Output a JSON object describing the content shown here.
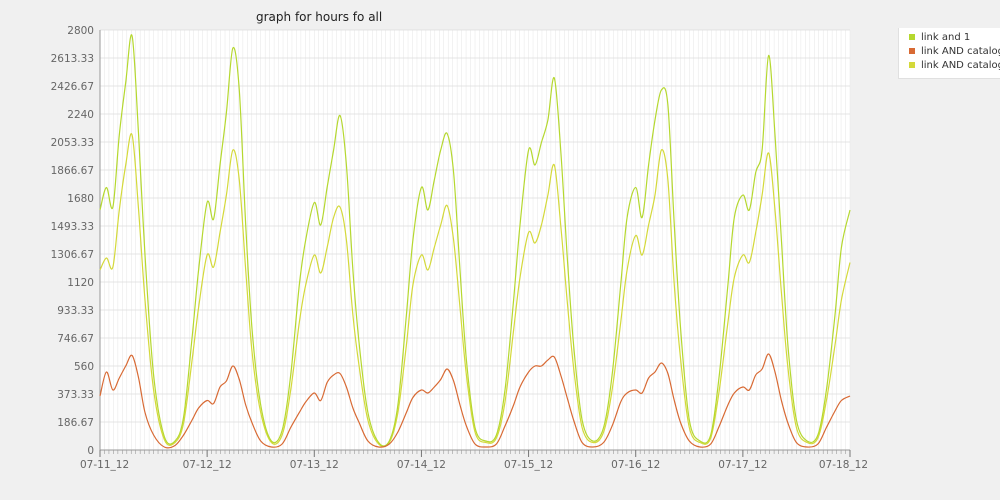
{
  "colors": {
    "background": "#f0f0f0",
    "plot_background": "#ffffff",
    "grid": "#e6e6e6",
    "axis": "#999999"
  },
  "chart_data": {
    "type": "line",
    "title": "graph for hours fo all",
    "xlabel": "",
    "ylabel": "",
    "ylim": [
      0,
      2800
    ],
    "y_ticks": [
      "0",
      "186.67",
      "373.33",
      "560",
      "746.67",
      "933.33",
      "1120",
      "1306.67",
      "1493.33",
      "1680",
      "1866.67",
      "2053.33",
      "2240",
      "2426.67",
      "2613.33",
      "2800"
    ],
    "x_ticks": [
      "07-11_12",
      "07-12_12",
      "07-13_12",
      "07-14_12",
      "07-15_12",
      "07-16_12",
      "07-17_12",
      "07-18_12"
    ],
    "grid": true,
    "legend_position": "top-right",
    "series": [
      {
        "name": "link and 1",
        "color": "#b5d82f",
        "x": [
          0,
          0.06,
          0.12,
          0.18,
          0.24,
          0.3,
          0.36,
          0.42,
          0.5,
          0.6,
          0.7,
          0.78,
          0.86,
          0.92,
          1.0,
          1.06,
          1.12,
          1.18,
          1.24,
          1.3,
          1.36,
          1.42,
          1.5,
          1.6,
          1.7,
          1.78,
          1.86,
          1.92,
          2.0,
          2.06,
          2.12,
          2.18,
          2.24,
          2.3,
          2.36,
          2.42,
          2.5,
          2.6,
          2.7,
          2.78,
          2.86,
          2.92,
          3.0,
          3.06,
          3.12,
          3.18,
          3.24,
          3.3,
          3.36,
          3.42,
          3.5,
          3.6,
          3.7,
          3.78,
          3.86,
          3.92,
          4.0,
          4.06,
          4.12,
          4.18,
          4.24,
          4.3,
          4.36,
          4.42,
          4.5,
          4.6,
          4.7,
          4.78,
          4.86,
          4.92,
          5.0,
          5.06,
          5.12,
          5.18,
          5.24,
          5.3,
          5.36,
          5.42,
          5.5,
          5.6,
          5.7,
          5.78,
          5.86,
          5.92,
          6.0,
          6.06,
          6.12,
          6.18,
          6.24,
          6.3,
          6.36,
          6.42,
          6.5,
          6.6,
          6.7,
          6.78,
          6.86,
          6.92,
          7.0
        ],
        "values": [
          1600,
          1750,
          1620,
          2100,
          2450,
          2760,
          2100,
          1300,
          500,
          90,
          60,
          220,
          750,
          1200,
          1650,
          1540,
          1900,
          2250,
          2680,
          2400,
          1500,
          800,
          300,
          60,
          130,
          500,
          1100,
          1400,
          1650,
          1500,
          1750,
          2000,
          2230,
          1900,
          1200,
          700,
          250,
          50,
          60,
          300,
          900,
          1400,
          1750,
          1600,
          1800,
          2000,
          2110,
          1850,
          1200,
          600,
          150,
          60,
          100,
          400,
          1000,
          1500,
          2000,
          1900,
          2050,
          2200,
          2480,
          2000,
          1300,
          700,
          200,
          60,
          150,
          500,
          1100,
          1550,
          1750,
          1550,
          1900,
          2200,
          2400,
          2300,
          1500,
          800,
          200,
          60,
          100,
          500,
          1100,
          1550,
          1700,
          1600,
          1850,
          2000,
          2630,
          2100,
          1400,
          700,
          200,
          60,
          100,
          400,
          900,
          1350,
          1600
        ]
      },
      {
        "name": "link AND catalog",
        "color": "#d86a34",
        "x": [
          0,
          0.06,
          0.12,
          0.18,
          0.24,
          0.3,
          0.36,
          0.42,
          0.5,
          0.6,
          0.7,
          0.78,
          0.86,
          0.92,
          1.0,
          1.06,
          1.12,
          1.18,
          1.24,
          1.3,
          1.36,
          1.42,
          1.5,
          1.6,
          1.7,
          1.78,
          1.86,
          1.92,
          2.0,
          2.06,
          2.12,
          2.18,
          2.24,
          2.3,
          2.36,
          2.42,
          2.5,
          2.6,
          2.7,
          2.78,
          2.86,
          2.92,
          3.0,
          3.06,
          3.12,
          3.18,
          3.24,
          3.3,
          3.36,
          3.42,
          3.5,
          3.6,
          3.7,
          3.78,
          3.86,
          3.92,
          4.0,
          4.06,
          4.12,
          4.18,
          4.24,
          4.3,
          4.36,
          4.42,
          4.5,
          4.6,
          4.7,
          4.78,
          4.86,
          4.92,
          5.0,
          5.06,
          5.12,
          5.18,
          5.24,
          5.3,
          5.36,
          5.42,
          5.5,
          5.6,
          5.7,
          5.78,
          5.86,
          5.92,
          6.0,
          6.06,
          6.12,
          6.18,
          6.24,
          6.3,
          6.36,
          6.42,
          6.5,
          6.6,
          6.7,
          6.78,
          6.86,
          6.92,
          7.0
        ],
        "values": [
          360,
          520,
          400,
          480,
          560,
          630,
          480,
          250,
          100,
          20,
          30,
          100,
          200,
          280,
          330,
          310,
          420,
          460,
          560,
          470,
          300,
          180,
          60,
          20,
          40,
          150,
          250,
          320,
          380,
          330,
          450,
          500,
          510,
          420,
          280,
          180,
          60,
          20,
          40,
          120,
          250,
          350,
          400,
          380,
          420,
          470,
          540,
          460,
          300,
          160,
          40,
          20,
          40,
          160,
          300,
          420,
          520,
          560,
          560,
          600,
          620,
          500,
          350,
          200,
          50,
          20,
          50,
          160,
          320,
          380,
          400,
          380,
          480,
          520,
          580,
          510,
          330,
          180,
          60,
          20,
          40,
          160,
          300,
          380,
          420,
          400,
          500,
          540,
          640,
          520,
          330,
          180,
          50,
          20,
          40,
          150,
          260,
          330,
          360
        ]
      },
      {
        "name": "link AND catalog",
        "color": "#d4d93a",
        "x": [
          0,
          0.06,
          0.12,
          0.18,
          0.24,
          0.3,
          0.36,
          0.42,
          0.5,
          0.6,
          0.7,
          0.78,
          0.86,
          0.92,
          1.0,
          1.06,
          1.12,
          1.18,
          1.24,
          1.3,
          1.36,
          1.42,
          1.5,
          1.6,
          1.7,
          1.78,
          1.86,
          1.92,
          2.0,
          2.06,
          2.12,
          2.18,
          2.24,
          2.3,
          2.36,
          2.42,
          2.5,
          2.6,
          2.7,
          2.78,
          2.86,
          2.92,
          3.0,
          3.06,
          3.12,
          3.18,
          3.24,
          3.3,
          3.36,
          3.42,
          3.5,
          3.6,
          3.7,
          3.78,
          3.86,
          3.92,
          4.0,
          4.06,
          4.12,
          4.18,
          4.24,
          4.3,
          4.36,
          4.42,
          4.5,
          4.6,
          4.7,
          4.78,
          4.86,
          4.92,
          5.0,
          5.06,
          5.12,
          5.18,
          5.24,
          5.3,
          5.36,
          5.42,
          5.5,
          5.6,
          5.7,
          5.78,
          5.86,
          5.92,
          6.0,
          6.06,
          6.12,
          6.18,
          6.24,
          6.3,
          6.36,
          6.42,
          6.5,
          6.6,
          6.7,
          6.78,
          6.86,
          6.92,
          7.0
        ],
        "values": [
          1200,
          1280,
          1220,
          1600,
          1900,
          2100,
          1600,
          1000,
          400,
          70,
          50,
          180,
          600,
          950,
          1300,
          1220,
          1450,
          1700,
          2000,
          1800,
          1200,
          650,
          250,
          50,
          100,
          400,
          850,
          1100,
          1300,
          1180,
          1350,
          1550,
          1620,
          1400,
          900,
          550,
          200,
          40,
          50,
          250,
          700,
          1100,
          1300,
          1200,
          1350,
          1500,
          1630,
          1400,
          950,
          500,
          120,
          50,
          80,
          320,
          800,
          1150,
          1450,
          1380,
          1500,
          1700,
          1900,
          1500,
          1000,
          550,
          150,
          50,
          120,
          400,
          850,
          1200,
          1430,
          1300,
          1500,
          1700,
          2000,
          1800,
          1100,
          600,
          150,
          50,
          80,
          400,
          850,
          1150,
          1300,
          1250,
          1450,
          1700,
          1980,
          1600,
          1050,
          550,
          150,
          50,
          80,
          330,
          700,
          1000,
          1250
        ]
      }
    ]
  }
}
